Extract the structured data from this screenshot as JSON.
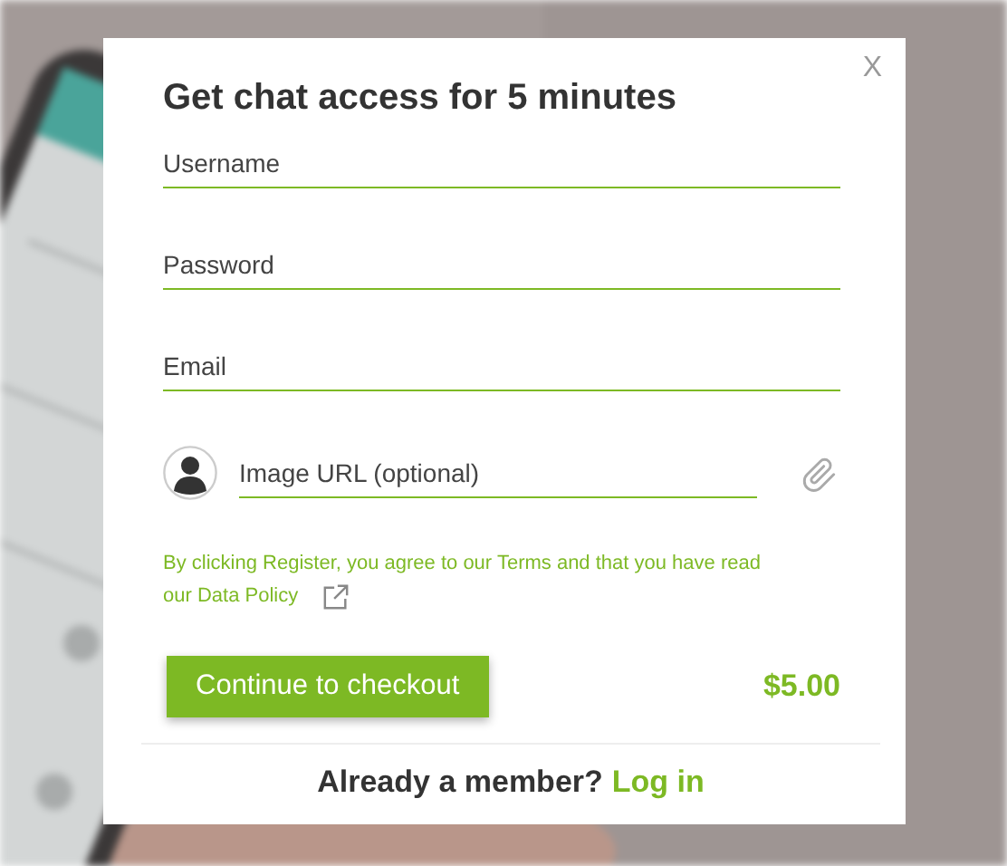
{
  "dialog": {
    "title": "Get chat access for 5 minutes",
    "close": "X",
    "fields": [
      {
        "placeholder": "Username"
      },
      {
        "placeholder": "Password"
      },
      {
        "placeholder": "Email"
      }
    ],
    "image_field": {
      "placeholder": "Image URL (optional)"
    },
    "notice": "By clicking Register, you agree to our Terms and that you have read our Data Policy",
    "checkout_button": "Continue to checkout",
    "price": "$5.00",
    "footer": {
      "text": "Already a member?",
      "link": "Log in"
    }
  }
}
